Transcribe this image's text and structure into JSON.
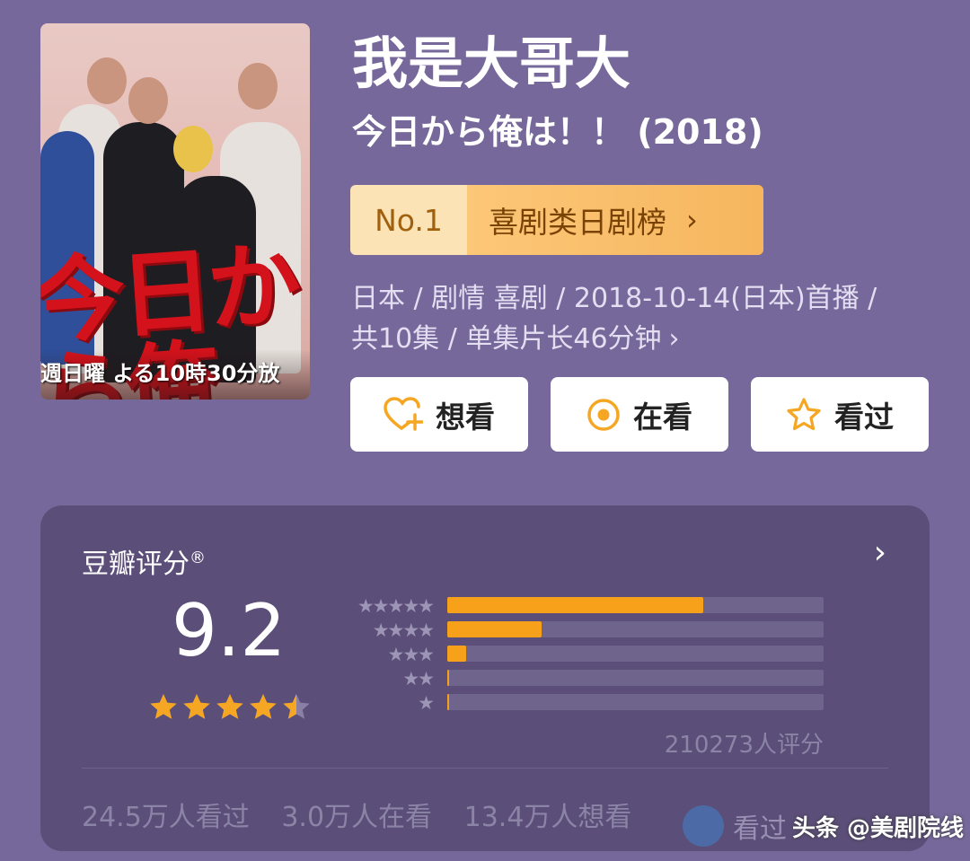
{
  "poster": {
    "title_art": "今日から俺",
    "broadcast_band": "週日曜 よる10時30分放"
  },
  "title": {
    "main": "我是大哥大",
    "original": "今日から俺は！！ (2018)"
  },
  "rank": {
    "number": "No.1",
    "list_label": "喜剧类日剧榜",
    "chevron_glyph": "›"
  },
  "meta": {
    "line1": "日本 / 剧情 喜剧 / 2018-10-14(日本)首播 /",
    "line2": "共10集 / 单集片长46分钟",
    "chevron_glyph": "›"
  },
  "actions": [
    {
      "label": "想看",
      "icon": "heart-plus-icon"
    },
    {
      "label": "在看",
      "icon": "target-circle-icon"
    },
    {
      "label": "看过",
      "icon": "star-outline-icon"
    }
  ],
  "rating": {
    "label": "豆瓣评分",
    "registered_mark": "®",
    "score": "9.2",
    "star_rating": 4.5,
    "distribution": [
      {
        "stars": "★★★★★",
        "fraction": 0.68
      },
      {
        "stars": "★★★★",
        "fraction": 0.25
      },
      {
        "stars": "★★★",
        "fraction": 0.05
      },
      {
        "stars": "★★",
        "fraction": 0.005
      },
      {
        "stars": "★",
        "fraction": 0.003
      }
    ],
    "count_text": "210273人评分",
    "stats": {
      "watched": "24.5万人看过",
      "watching": "3.0万人在看",
      "want": "13.4万人想看"
    },
    "more_glyph": "›"
  },
  "watermark": {
    "ghost_text": "看过",
    "text": "头条 @美剧院线"
  },
  "colors": {
    "background": "#76689a",
    "card": "#5b4e78",
    "accent": "#f7a11a",
    "star": "#f5a623"
  }
}
